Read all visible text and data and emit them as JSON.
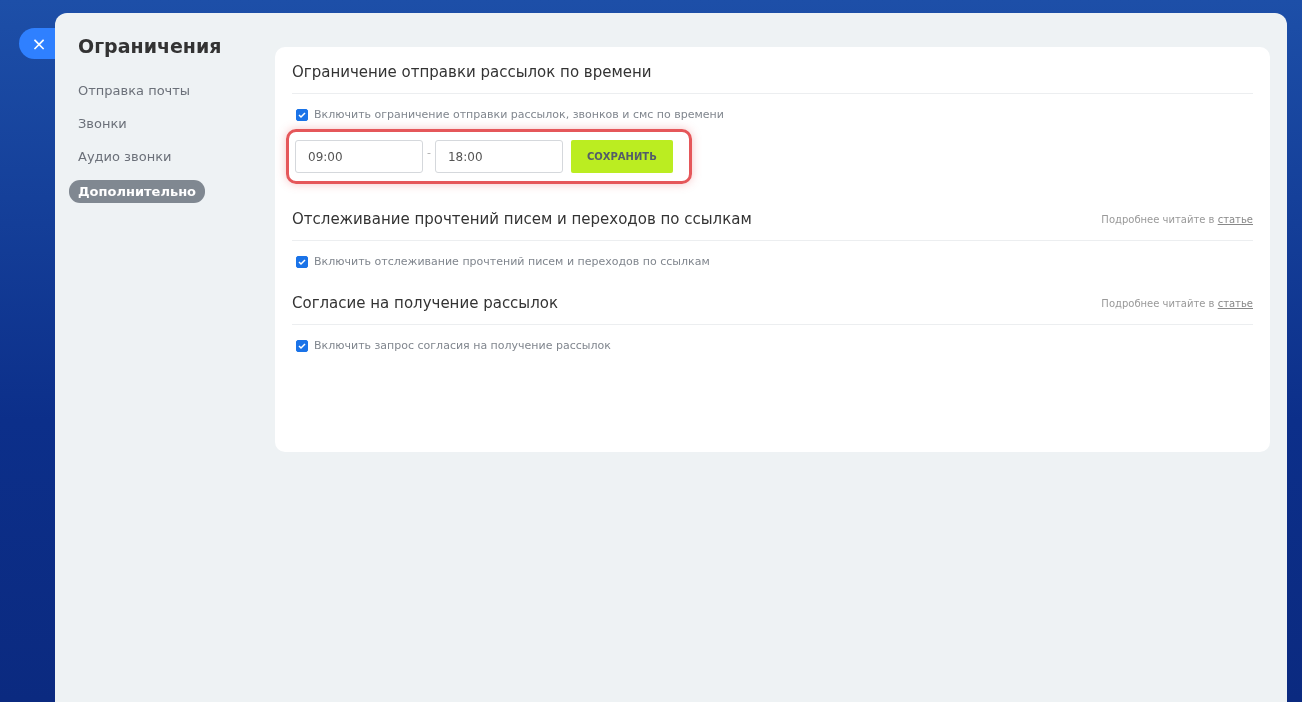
{
  "close_button": {
    "label": "×"
  },
  "sidebar": {
    "title": "Ограничения",
    "items": [
      {
        "label": "Отправка почты",
        "selected": false
      },
      {
        "label": "Звонки",
        "selected": false
      },
      {
        "label": "Аудио звонки",
        "selected": false
      },
      {
        "label": "Дополнительно",
        "selected": true
      }
    ]
  },
  "sections": [
    {
      "title": "Ограничение отправки рассылок по времени",
      "checkbox": {
        "label": "Включить ограничение отправки рассылок, звонков и смс по времени",
        "checked": true
      },
      "time_range": {
        "from": "09:00",
        "separator": "-",
        "to": "18:00",
        "save_button": "СОХРАНИТЬ",
        "highlighted": true
      }
    },
    {
      "title": "Отслеживание прочтений писем и переходов по ссылкам",
      "note": {
        "text": "Подробнее читайте в",
        "link": "статье"
      },
      "checkbox": {
        "label": "Включить отслеживание прочтений писем и переходов по ссылкам",
        "checked": true
      }
    },
    {
      "title": "Согласие на получение рассылок",
      "note": {
        "text": "Подробнее читайте в",
        "link": "статье"
      },
      "checkbox": {
        "label": "Включить запрос согласия на получение рассылок",
        "checked": true
      }
    }
  ]
}
